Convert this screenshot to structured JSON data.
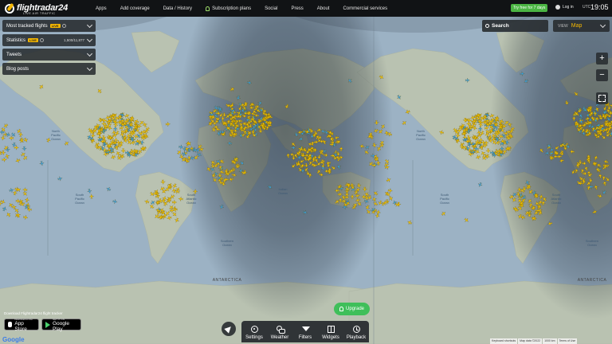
{
  "brand": {
    "name": "flightradar24",
    "tagline": "LIVE AIR TRAFFIC"
  },
  "nav": {
    "items": [
      "Apps",
      "Add coverage",
      "Data / History",
      "Subscription plans",
      "Social",
      "Press",
      "About",
      "Commercial services"
    ]
  },
  "header": {
    "trial_label": "Try free for 7 days",
    "login_label": "Log in",
    "utc_label": "UTC",
    "time": "19:05"
  },
  "panels": {
    "most_tracked": "Most tracked flights",
    "statistics": "Statistics",
    "statistics_value": "1,500/11,877",
    "tweets": "Tweets",
    "blog_posts": "Blog posts",
    "live_badge": "LIVE"
  },
  "search": {
    "label": "Search"
  },
  "view": {
    "label": "VIEW",
    "value": "Map"
  },
  "zoom": {
    "in": "+",
    "out": "−"
  },
  "map_labels": {
    "north_pacific": "North\nPacific\nOcean",
    "south_pacific": "South\nPacific\nOcean",
    "south_atlantic": "South\nAtlantic\nOcean",
    "indian": "Indian\nOcean",
    "southern": "Southern\nOcean",
    "antarctica": "ANTARCTICA"
  },
  "apps": {
    "download_text": "Download Flightradar24 flight tracker",
    "app_store_small": "Download on the",
    "app_store": "App Store",
    "google_play_small": "GET IT ON",
    "google_play": "Google Play"
  },
  "upgrade_label": "Upgrade",
  "toolbar": {
    "items": [
      "Settings",
      "Weather",
      "Filters",
      "Widgets",
      "Playback"
    ]
  },
  "footer": {
    "google": "Google",
    "keyboard": "Keyboard shortcuts",
    "map_data": "Map data ©2022",
    "scale": "1000 km",
    "terms": "Terms of Use"
  },
  "colors": {
    "accent": "#f5b700",
    "plane_yellow": "#f5c400",
    "plane_blue": "#3aa0e0",
    "topbar": "#111315",
    "upgrade": "#3fbf5a"
  }
}
